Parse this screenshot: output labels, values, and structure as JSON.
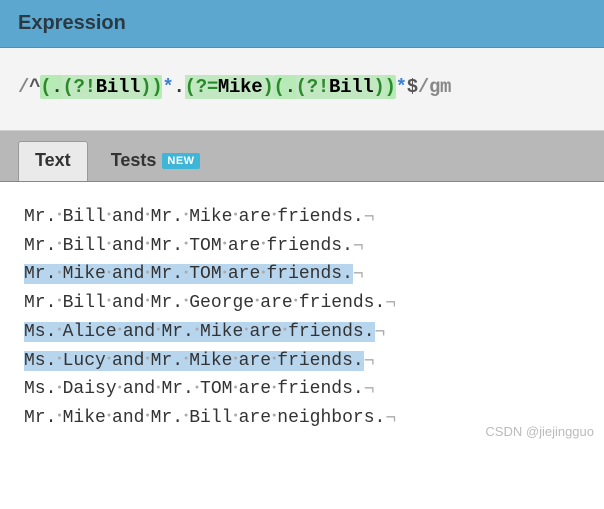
{
  "header": {
    "title": "Expression"
  },
  "expression": {
    "open_delim": "/",
    "anchor_start": "^",
    "group_open": "(",
    "dot": ".",
    "neg_look_open": "(?!",
    "neg_look_text": "Bill",
    "neg_look_close": ")",
    "group_close": ")",
    "star": "*",
    "pos_look_open": "(?=",
    "pos_look_text": "Mike",
    "pos_look_close": ")",
    "anchor_end": "$",
    "close_delim": "/",
    "flags": "gm"
  },
  "tabs": {
    "text_label": "Text",
    "tests_label": "Tests",
    "badge": "NEW"
  },
  "test_lines": [
    {
      "words": [
        "Mr.",
        "Bill",
        "and",
        "Mr.",
        "Mike",
        "are",
        "friends."
      ],
      "match": false
    },
    {
      "words": [
        "Mr.",
        "Bill",
        "and",
        "Mr.",
        "TOM",
        "are",
        "friends."
      ],
      "match": false
    },
    {
      "words": [
        "Mr.",
        "Mike",
        "and",
        "Mr.",
        "TOM",
        "are",
        "friends."
      ],
      "match": true
    },
    {
      "words": [
        "Mr.",
        "Bill",
        "and",
        "Mr.",
        "George",
        "are",
        "friends."
      ],
      "match": false
    },
    {
      "words": [
        "Ms.",
        "Alice",
        "and",
        "Mr.",
        "Mike",
        "are",
        "friends."
      ],
      "match": true
    },
    {
      "words": [
        "Ms.",
        "Lucy",
        "and",
        "Mr.",
        "Mike",
        "are",
        "friends."
      ],
      "match": true
    },
    {
      "words": [
        "Ms.",
        "Daisy",
        "and",
        "Mr.",
        "TOM",
        "are",
        "friends."
      ],
      "match": false
    },
    {
      "words": [
        "Mr.",
        "Mike",
        "and",
        "Mr.",
        "Bill",
        "are",
        "neighbors."
      ],
      "match": false
    }
  ],
  "watermark": "CSDN @jiejingguo"
}
